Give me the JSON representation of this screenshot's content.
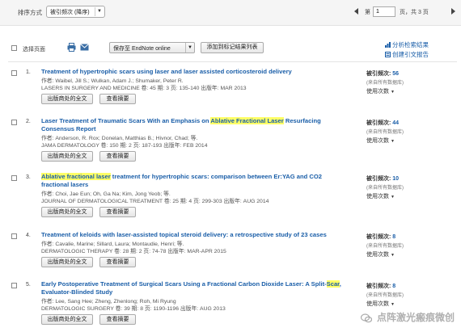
{
  "sort": {
    "label": "排序方式",
    "selected": "被引频次 (降序)"
  },
  "pager": {
    "page_label": "第",
    "page_value": "1",
    "of_text": "页，共 3 页"
  },
  "toolbar": {
    "select_page_label": "选择页面",
    "endnote_label": "保存至 EndNote online",
    "marklist_label": "添加到标记结果列表",
    "analyze_label": "分析检索结果",
    "citation_report_label": "创建引文报告"
  },
  "record_labels": {
    "fulltext_button": "出版商处的全文",
    "abstract_button": "查看摘要",
    "cited_prefix": "被引频次: ",
    "source_note": "(来自所有数据库)",
    "usage_label": "使用次数"
  },
  "records": [
    {
      "num": "1.",
      "title_parts": [
        {
          "text": "Treatment of hypertrophic scars using laser and laser assisted corticosteroid delivery",
          "hl": false
        }
      ],
      "authors": "作者: Waibel, Jill S.; Wulkan, Adam J.; Shumaker, Peter R.",
      "journal": "LASERS IN SURGERY AND MEDICINE  卷: 45  期: 3  页: 135-140  出版年: MAR 2013",
      "cited": "56"
    },
    {
      "num": "2.",
      "title_parts": [
        {
          "text": "Laser Treatment of Traumatic Scars With an Emphasis on ",
          "hl": false
        },
        {
          "text": "Ablative Fractional Laser",
          "hl": true
        },
        {
          "text": " Resurfacing Consensus Report",
          "hl": false
        }
      ],
      "authors": "作者: Anderson, R. Rox; Donelan, Matthias B.; Hivnor, Chad; 等.",
      "journal": "JAMA DERMATOLOGY  卷: 150  期: 2  页: 187-193  出版年: FEB 2014",
      "cited": "44"
    },
    {
      "num": "3.",
      "title_parts": [
        {
          "text": "Ablative fractional laser",
          "hl": true
        },
        {
          "text": " treatment for hypertrophic scars: comparison between Er:YAG and CO2 fractional lasers",
          "hl": false
        }
      ],
      "authors": "作者: Choi, Jae Eun; Oh, Ga Na; Kim, Jong Yeob; 等.",
      "journal": "JOURNAL OF DERMATOLOGICAL TREATMENT  卷: 25  期: 4  页: 299-303  出版年: AUG 2014",
      "cited": "10"
    },
    {
      "num": "4.",
      "title_parts": [
        {
          "text": "Treatment of keloids with laser-assisted topical steroid delivery: a retrospective study of 23 cases",
          "hl": false
        }
      ],
      "authors": "作者: Cavalie, Marine; Sillard, Laura; Montaudie, Henri; 等.",
      "journal": "DERMATOLOGIC THERAPY  卷: 28  期: 2  页: 74-78  出版年: MAR-APR 2015",
      "cited": "8"
    },
    {
      "num": "5.",
      "title_parts": [
        {
          "text": "Early Postoperative Treatment of Surgical Scars Using a Fractional Carbon Dioxide Laser: A Split-",
          "hl": false
        },
        {
          "text": "Scar",
          "hl": true
        },
        {
          "text": ", Evaluator-Blinded Study",
          "hl": false
        }
      ],
      "authors": "作者: Lee, Sang Hee; Zheng, Zhenlong; Roh, Mi Ryung",
      "journal": "DERMATOLOGIC SURGERY  卷: 39  期: 8  页: 1190-1196  出版年: AUG 2013",
      "cited": "8"
    }
  ],
  "watermark": {
    "text": "点阵激光瘢痕微创",
    "icon": "wechat-icon"
  },
  "colors": {
    "link": "#1a5ea8",
    "highlight": "#ffff66"
  }
}
